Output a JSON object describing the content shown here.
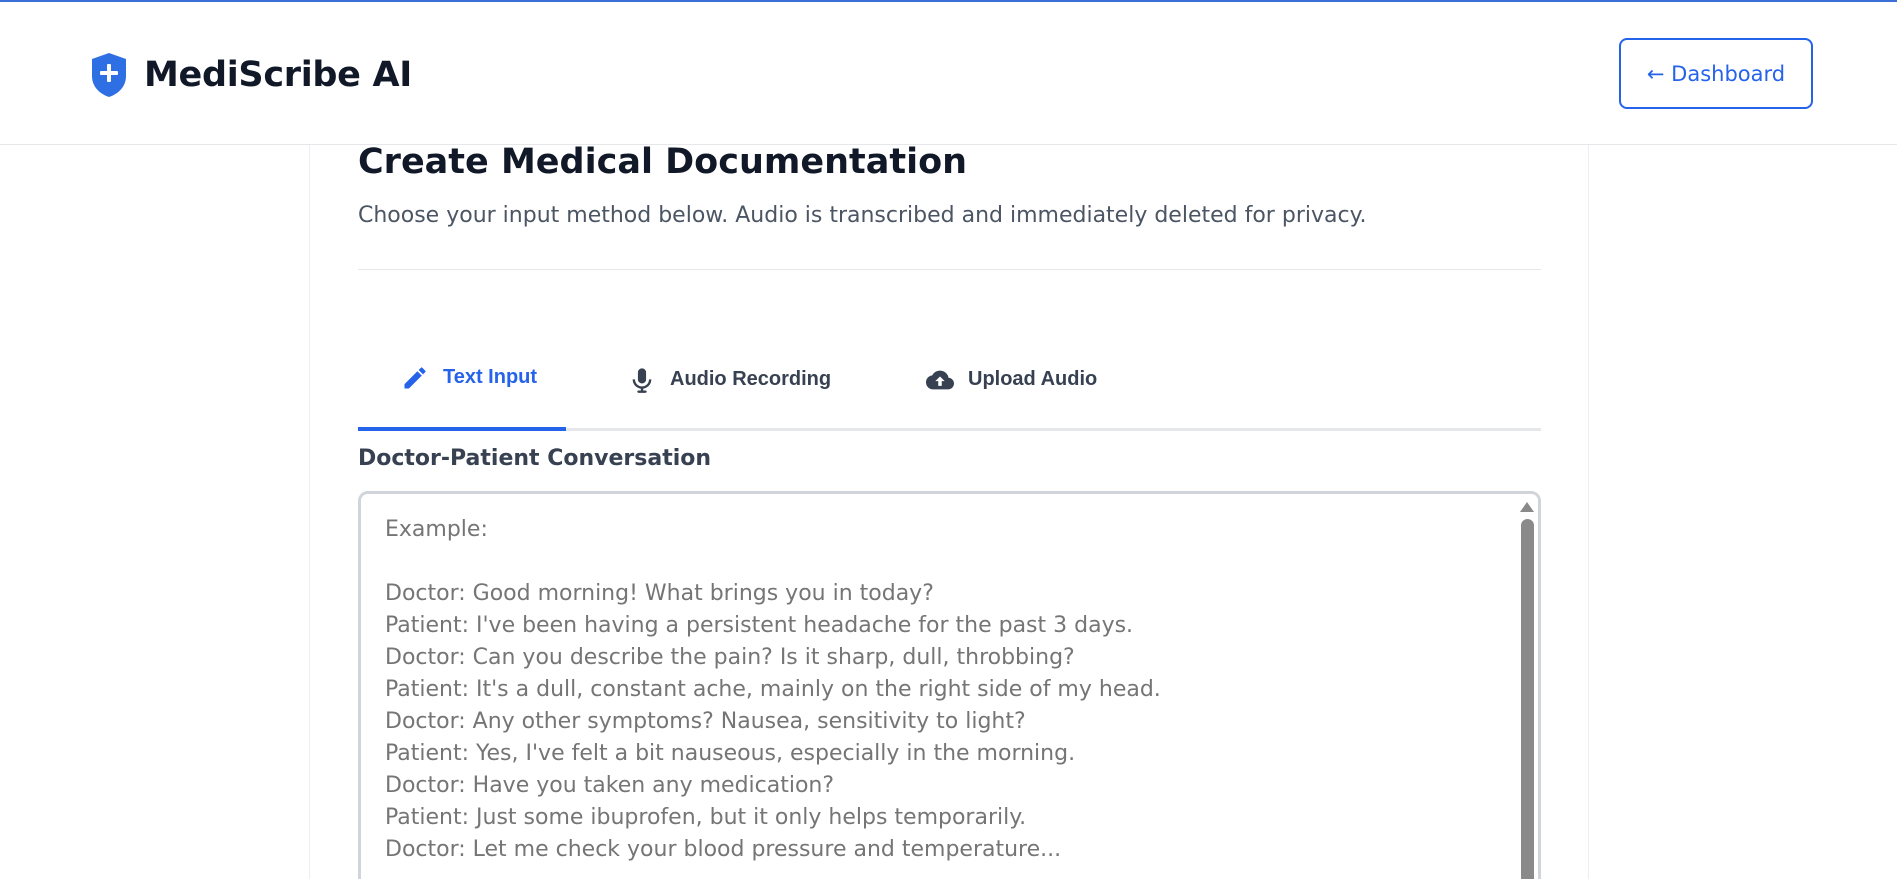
{
  "app": {
    "name": "MediScribe AI",
    "accent_color": "#2563eb"
  },
  "header": {
    "logo_icon": "shield-plus-icon",
    "dashboard_button": "← Dashboard"
  },
  "page": {
    "title": "Create Medical Documentation",
    "subtitle": "Choose your input method below. Audio is transcribed and immediately deleted for privacy."
  },
  "tabs": [
    {
      "label": "Text Input",
      "icon": "pencil-icon",
      "active": true
    },
    {
      "label": "Audio Recording",
      "icon": "microphone-icon",
      "active": false
    },
    {
      "label": "Upload Audio",
      "icon": "cloud-upload-icon",
      "active": false
    }
  ],
  "conversation": {
    "label": "Doctor-Patient Conversation",
    "value": "",
    "placeholder": "Example:\n\nDoctor: Good morning! What brings you in today?\nPatient: I've been having a persistent headache for the past 3 days.\nDoctor: Can you describe the pain? Is it sharp, dull, throbbing?\nPatient: It's a dull, constant ache, mainly on the right side of my head.\nDoctor: Any other symptoms? Nausea, sensitivity to light?\nPatient: Yes, I've felt a bit nauseous, especially in the morning.\nDoctor: Have you taken any medication?\nPatient: Just some ibuprofen, but it only helps temporarily.\nDoctor: Let me check your blood pressure and temperature..."
  }
}
